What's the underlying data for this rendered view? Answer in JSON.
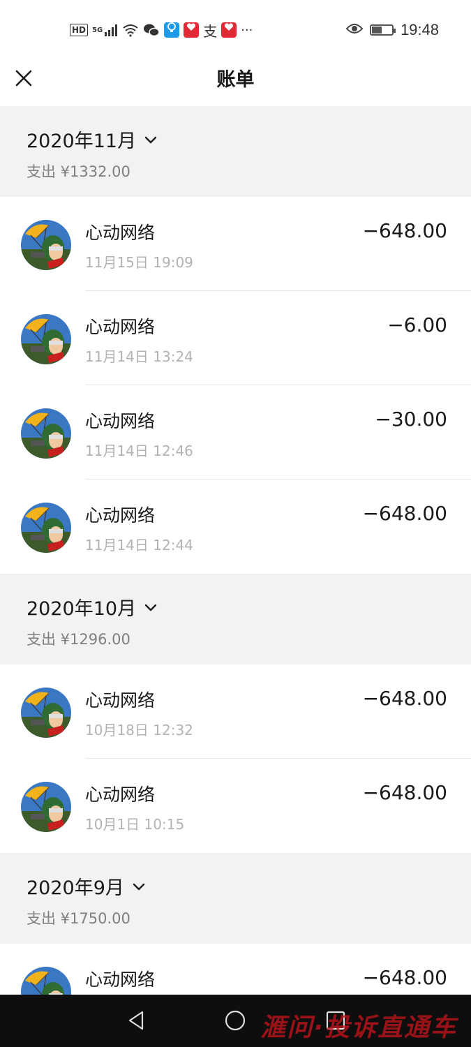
{
  "status_bar": {
    "hd": "HD",
    "signal": "5G",
    "app_icon_1": "hongbao-app-icon",
    "app_icon_2": "hongbao-app-icon",
    "zhi": "支",
    "more": "···",
    "time": "19:48",
    "battery_level": 0.5
  },
  "header": {
    "title": "账单"
  },
  "months": [
    {
      "title": "2020年11月",
      "summary": "支出 ¥1332.00",
      "items": [
        {
          "merchant": "心动网络",
          "time": "11月15日 19:09",
          "amount": "−648.00"
        },
        {
          "merchant": "心动网络",
          "time": "11月14日 13:24",
          "amount": "−6.00"
        },
        {
          "merchant": "心动网络",
          "time": "11月14日 12:46",
          "amount": "−30.00"
        },
        {
          "merchant": "心动网络",
          "time": "11月14日 12:44",
          "amount": "−648.00"
        }
      ]
    },
    {
      "title": "2020年10月",
      "summary": "支出 ¥1296.00",
      "items": [
        {
          "merchant": "心动网络",
          "time": "10月18日 12:32",
          "amount": "−648.00"
        },
        {
          "merchant": "心动网络",
          "time": "10月1日 10:15",
          "amount": "−648.00"
        }
      ]
    },
    {
      "title": "2020年9月",
      "summary": "支出 ¥1750.00",
      "items": [
        {
          "merchant": "心动网络",
          "time": "",
          "amount": "−648.00"
        }
      ]
    }
  ],
  "watermark": "滙问·投诉直通车",
  "colors": {
    "month_bg": "#f2f2f2",
    "secondary_text": "#7f7f7f",
    "time_text": "#b2b2b2",
    "nav_bar": "#0e0e0e",
    "watermark": "#c8141c"
  }
}
